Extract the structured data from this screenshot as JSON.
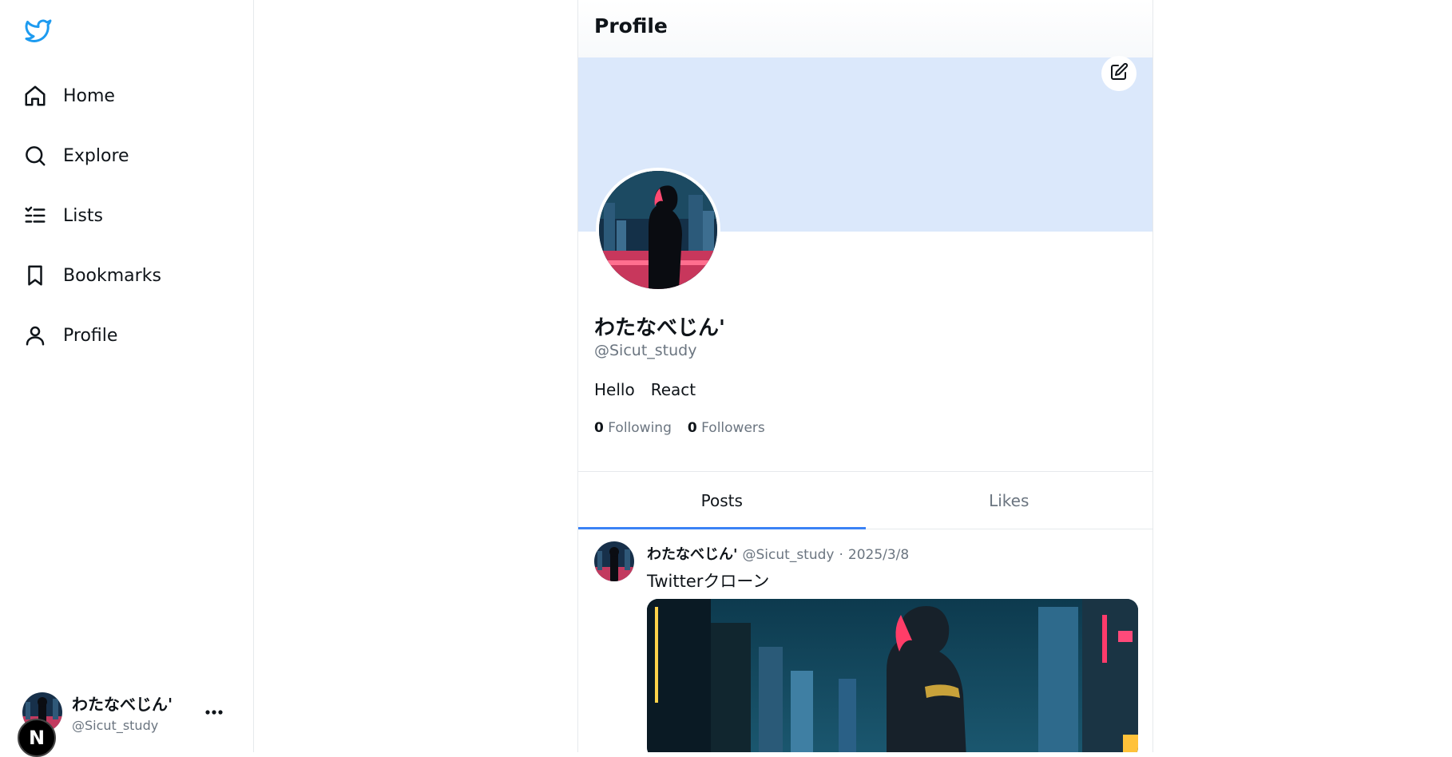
{
  "sidebar": {
    "items": [
      {
        "label": "Home",
        "icon": "home-icon"
      },
      {
        "label": "Explore",
        "icon": "search-icon"
      },
      {
        "label": "Lists",
        "icon": "list-icon"
      },
      {
        "label": "Bookmarks",
        "icon": "bookmark-icon"
      },
      {
        "label": "Profile",
        "icon": "user-icon"
      }
    ],
    "account": {
      "name": "わたなべじん'",
      "handle": "@Sicut_study"
    },
    "badge": "N"
  },
  "header": {
    "title": "Profile"
  },
  "profile": {
    "name": "わたなべじん'",
    "handle": "@Sicut_study",
    "bio": [
      "Hello",
      "React"
    ],
    "following_count": "0",
    "following_label": "Following",
    "followers_count": "0",
    "followers_label": "Followers"
  },
  "tabs": [
    {
      "label": "Posts",
      "active": true
    },
    {
      "label": "Likes",
      "active": false
    }
  ],
  "post": {
    "author": "わたなべじん'",
    "handle": "@Sicut_study",
    "separator": "·",
    "date": "2025/3/8",
    "text": "Twitterクローン"
  },
  "colors": {
    "accent": "#1d9bf0",
    "tab_underline": "#3b82f6",
    "banner": "#dbe8fb"
  }
}
